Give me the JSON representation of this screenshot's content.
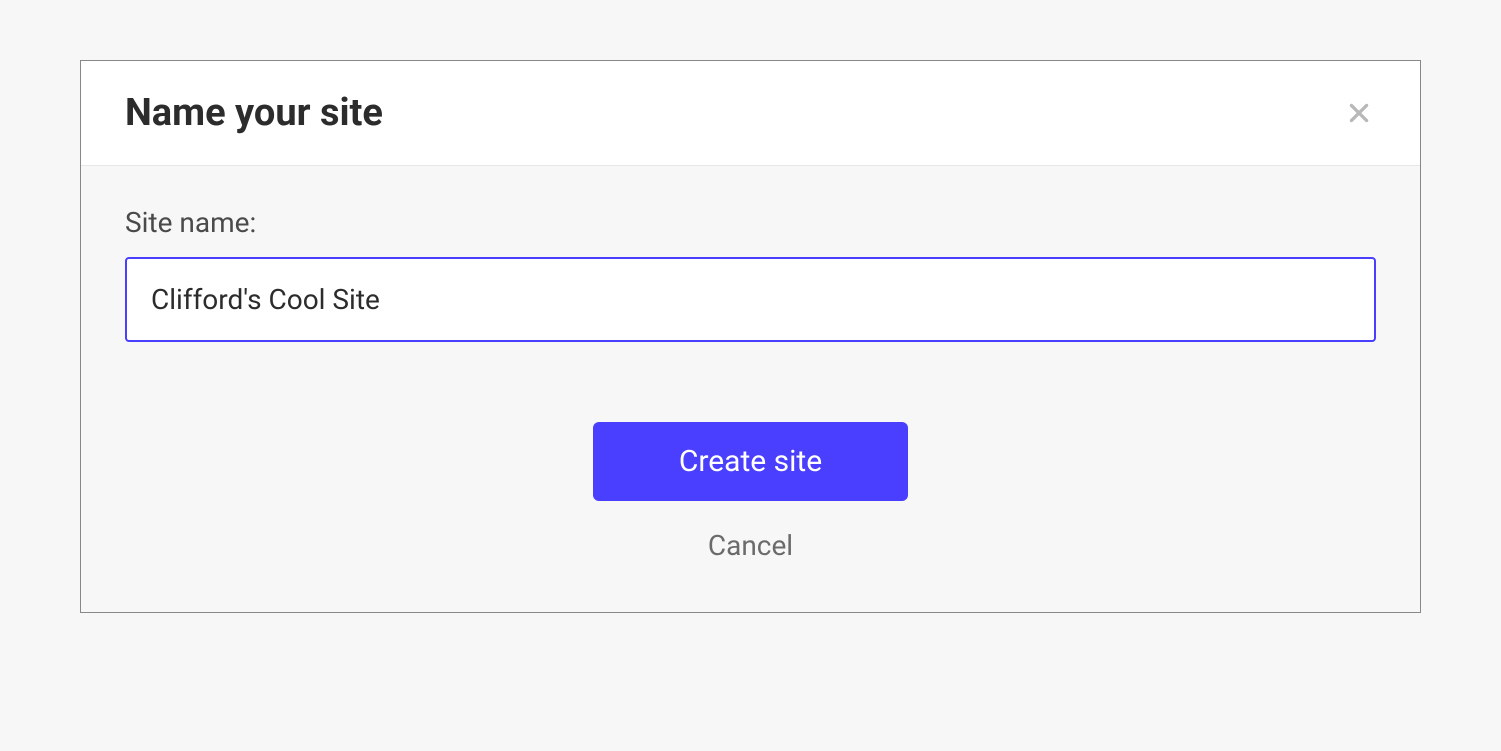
{
  "dialog": {
    "title": "Name your site",
    "field_label": "Site name:",
    "site_name_value": "Clifford's Cool Site",
    "create_button": "Create site",
    "cancel_button": "Cancel"
  }
}
